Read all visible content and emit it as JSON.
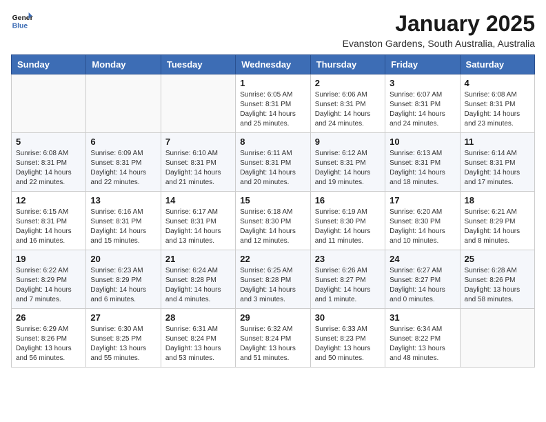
{
  "logo": {
    "text_general": "General",
    "text_blue": "Blue"
  },
  "header": {
    "month_year": "January 2025",
    "location": "Evanston Gardens, South Australia, Australia"
  },
  "weekdays": [
    "Sunday",
    "Monday",
    "Tuesday",
    "Wednesday",
    "Thursday",
    "Friday",
    "Saturday"
  ],
  "weeks": [
    [
      {
        "day": "",
        "info": ""
      },
      {
        "day": "",
        "info": ""
      },
      {
        "day": "",
        "info": ""
      },
      {
        "day": "1",
        "info": "Sunrise: 6:05 AM\nSunset: 8:31 PM\nDaylight: 14 hours\nand 25 minutes."
      },
      {
        "day": "2",
        "info": "Sunrise: 6:06 AM\nSunset: 8:31 PM\nDaylight: 14 hours\nand 24 minutes."
      },
      {
        "day": "3",
        "info": "Sunrise: 6:07 AM\nSunset: 8:31 PM\nDaylight: 14 hours\nand 24 minutes."
      },
      {
        "day": "4",
        "info": "Sunrise: 6:08 AM\nSunset: 8:31 PM\nDaylight: 14 hours\nand 23 minutes."
      }
    ],
    [
      {
        "day": "5",
        "info": "Sunrise: 6:08 AM\nSunset: 8:31 PM\nDaylight: 14 hours\nand 22 minutes."
      },
      {
        "day": "6",
        "info": "Sunrise: 6:09 AM\nSunset: 8:31 PM\nDaylight: 14 hours\nand 22 minutes."
      },
      {
        "day": "7",
        "info": "Sunrise: 6:10 AM\nSunset: 8:31 PM\nDaylight: 14 hours\nand 21 minutes."
      },
      {
        "day": "8",
        "info": "Sunrise: 6:11 AM\nSunset: 8:31 PM\nDaylight: 14 hours\nand 20 minutes."
      },
      {
        "day": "9",
        "info": "Sunrise: 6:12 AM\nSunset: 8:31 PM\nDaylight: 14 hours\nand 19 minutes."
      },
      {
        "day": "10",
        "info": "Sunrise: 6:13 AM\nSunset: 8:31 PM\nDaylight: 14 hours\nand 18 minutes."
      },
      {
        "day": "11",
        "info": "Sunrise: 6:14 AM\nSunset: 8:31 PM\nDaylight: 14 hours\nand 17 minutes."
      }
    ],
    [
      {
        "day": "12",
        "info": "Sunrise: 6:15 AM\nSunset: 8:31 PM\nDaylight: 14 hours\nand 16 minutes."
      },
      {
        "day": "13",
        "info": "Sunrise: 6:16 AM\nSunset: 8:31 PM\nDaylight: 14 hours\nand 15 minutes."
      },
      {
        "day": "14",
        "info": "Sunrise: 6:17 AM\nSunset: 8:31 PM\nDaylight: 14 hours\nand 13 minutes."
      },
      {
        "day": "15",
        "info": "Sunrise: 6:18 AM\nSunset: 8:30 PM\nDaylight: 14 hours\nand 12 minutes."
      },
      {
        "day": "16",
        "info": "Sunrise: 6:19 AM\nSunset: 8:30 PM\nDaylight: 14 hours\nand 11 minutes."
      },
      {
        "day": "17",
        "info": "Sunrise: 6:20 AM\nSunset: 8:30 PM\nDaylight: 14 hours\nand 10 minutes."
      },
      {
        "day": "18",
        "info": "Sunrise: 6:21 AM\nSunset: 8:29 PM\nDaylight: 14 hours\nand 8 minutes."
      }
    ],
    [
      {
        "day": "19",
        "info": "Sunrise: 6:22 AM\nSunset: 8:29 PM\nDaylight: 14 hours\nand 7 minutes."
      },
      {
        "day": "20",
        "info": "Sunrise: 6:23 AM\nSunset: 8:29 PM\nDaylight: 14 hours\nand 6 minutes."
      },
      {
        "day": "21",
        "info": "Sunrise: 6:24 AM\nSunset: 8:28 PM\nDaylight: 14 hours\nand 4 minutes."
      },
      {
        "day": "22",
        "info": "Sunrise: 6:25 AM\nSunset: 8:28 PM\nDaylight: 14 hours\nand 3 minutes."
      },
      {
        "day": "23",
        "info": "Sunrise: 6:26 AM\nSunset: 8:27 PM\nDaylight: 14 hours\nand 1 minute."
      },
      {
        "day": "24",
        "info": "Sunrise: 6:27 AM\nSunset: 8:27 PM\nDaylight: 14 hours\nand 0 minutes."
      },
      {
        "day": "25",
        "info": "Sunrise: 6:28 AM\nSunset: 8:26 PM\nDaylight: 13 hours\nand 58 minutes."
      }
    ],
    [
      {
        "day": "26",
        "info": "Sunrise: 6:29 AM\nSunset: 8:26 PM\nDaylight: 13 hours\nand 56 minutes."
      },
      {
        "day": "27",
        "info": "Sunrise: 6:30 AM\nSunset: 8:25 PM\nDaylight: 13 hours\nand 55 minutes."
      },
      {
        "day": "28",
        "info": "Sunrise: 6:31 AM\nSunset: 8:24 PM\nDaylight: 13 hours\nand 53 minutes."
      },
      {
        "day": "29",
        "info": "Sunrise: 6:32 AM\nSunset: 8:24 PM\nDaylight: 13 hours\nand 51 minutes."
      },
      {
        "day": "30",
        "info": "Sunrise: 6:33 AM\nSunset: 8:23 PM\nDaylight: 13 hours\nand 50 minutes."
      },
      {
        "day": "31",
        "info": "Sunrise: 6:34 AM\nSunset: 8:22 PM\nDaylight: 13 hours\nand 48 minutes."
      },
      {
        "day": "",
        "info": ""
      }
    ]
  ]
}
